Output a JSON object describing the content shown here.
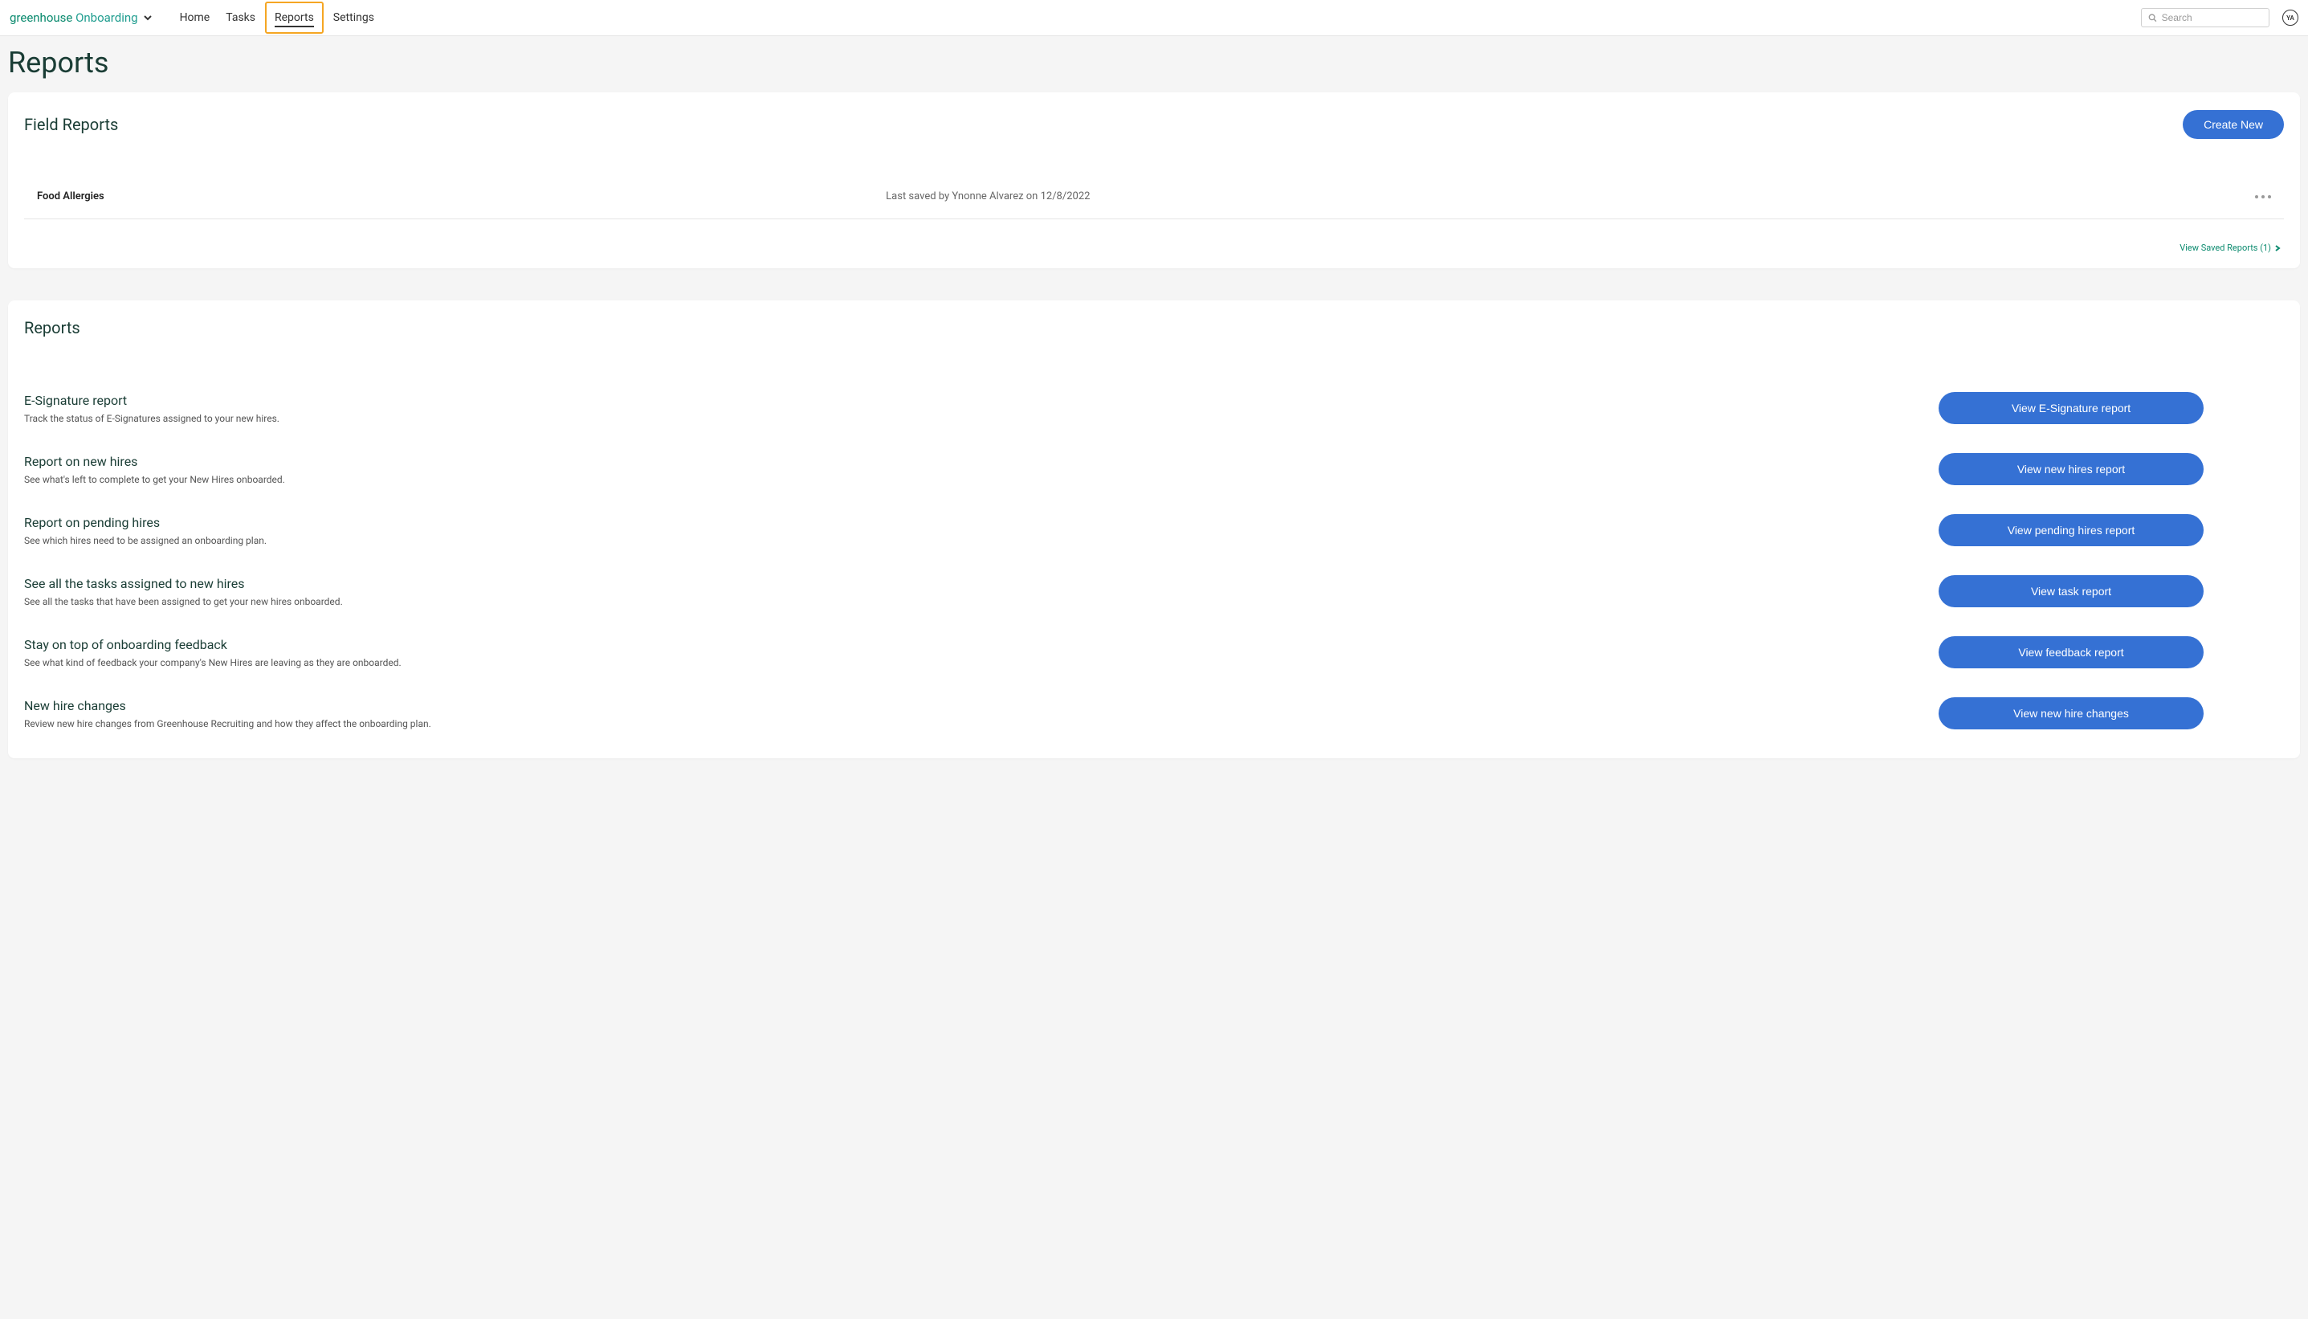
{
  "header": {
    "logo_main": "greenhouse",
    "logo_sub": " Onboarding",
    "nav": {
      "home": "Home",
      "tasks": "Tasks",
      "reports": "Reports",
      "settings": "Settings"
    },
    "search_placeholder": "Search",
    "avatar_initials": "YA"
  },
  "page": {
    "title": "Reports"
  },
  "field_reports": {
    "title": "Field Reports",
    "create_label": "Create New",
    "items": [
      {
        "name": "Food Allergies",
        "meta": "Last saved by Ynonne Alvarez on 12/8/2022"
      }
    ],
    "view_saved_label": "View Saved Reports (1)"
  },
  "reports_section": {
    "title": "Reports",
    "items": [
      {
        "title": "E-Signature report",
        "desc": "Track the status of E-Signatures assigned to your new hires.",
        "button": "View E-Signature report"
      },
      {
        "title": "Report on new hires",
        "desc": "See what's left to complete to get your New Hires onboarded.",
        "button": "View new hires report"
      },
      {
        "title": "Report on pending hires",
        "desc": "See which hires need to be assigned an onboarding plan.",
        "button": "View pending hires report"
      },
      {
        "title": "See all the tasks assigned to new hires",
        "desc": "See all the tasks that have been assigned to get your new hires onboarded.",
        "button": "View task report"
      },
      {
        "title": "Stay on top of onboarding feedback",
        "desc": "See what kind of feedback your company's New Hires are leaving as they are onboarded.",
        "button": "View feedback report"
      },
      {
        "title": "New hire changes",
        "desc": "Review new hire changes from Greenhouse Recruiting and how they affect the onboarding plan.",
        "button": "View new hire changes"
      }
    ]
  }
}
